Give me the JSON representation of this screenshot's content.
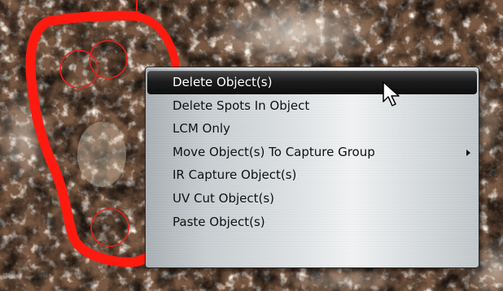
{
  "context_menu": {
    "items": [
      {
        "label": "Delete Object(s)",
        "highlighted": true,
        "has_submenu": false
      },
      {
        "label": "Delete Spots In Object",
        "highlighted": false,
        "has_submenu": false
      },
      {
        "label": "LCM Only",
        "highlighted": false,
        "has_submenu": false
      },
      {
        "label": "Move Object(s) To Capture Group",
        "highlighted": false,
        "has_submenu": true
      },
      {
        "label": "IR Capture Object(s)",
        "highlighted": false,
        "has_submenu": false
      },
      {
        "label": "UV Cut Object(s)",
        "highlighted": false,
        "has_submenu": false
      },
      {
        "label": "Paste Object(s)",
        "highlighted": false,
        "has_submenu": false
      }
    ]
  },
  "colors": {
    "annotation_outline": "#ff1a10",
    "capture_spot": "#e8201a",
    "menu_highlight": "#141414",
    "tissue_base": "#6b4a36"
  },
  "icons": {
    "cursor": "arrow-pointer-icon",
    "submenu": "chevron-right-icon"
  }
}
